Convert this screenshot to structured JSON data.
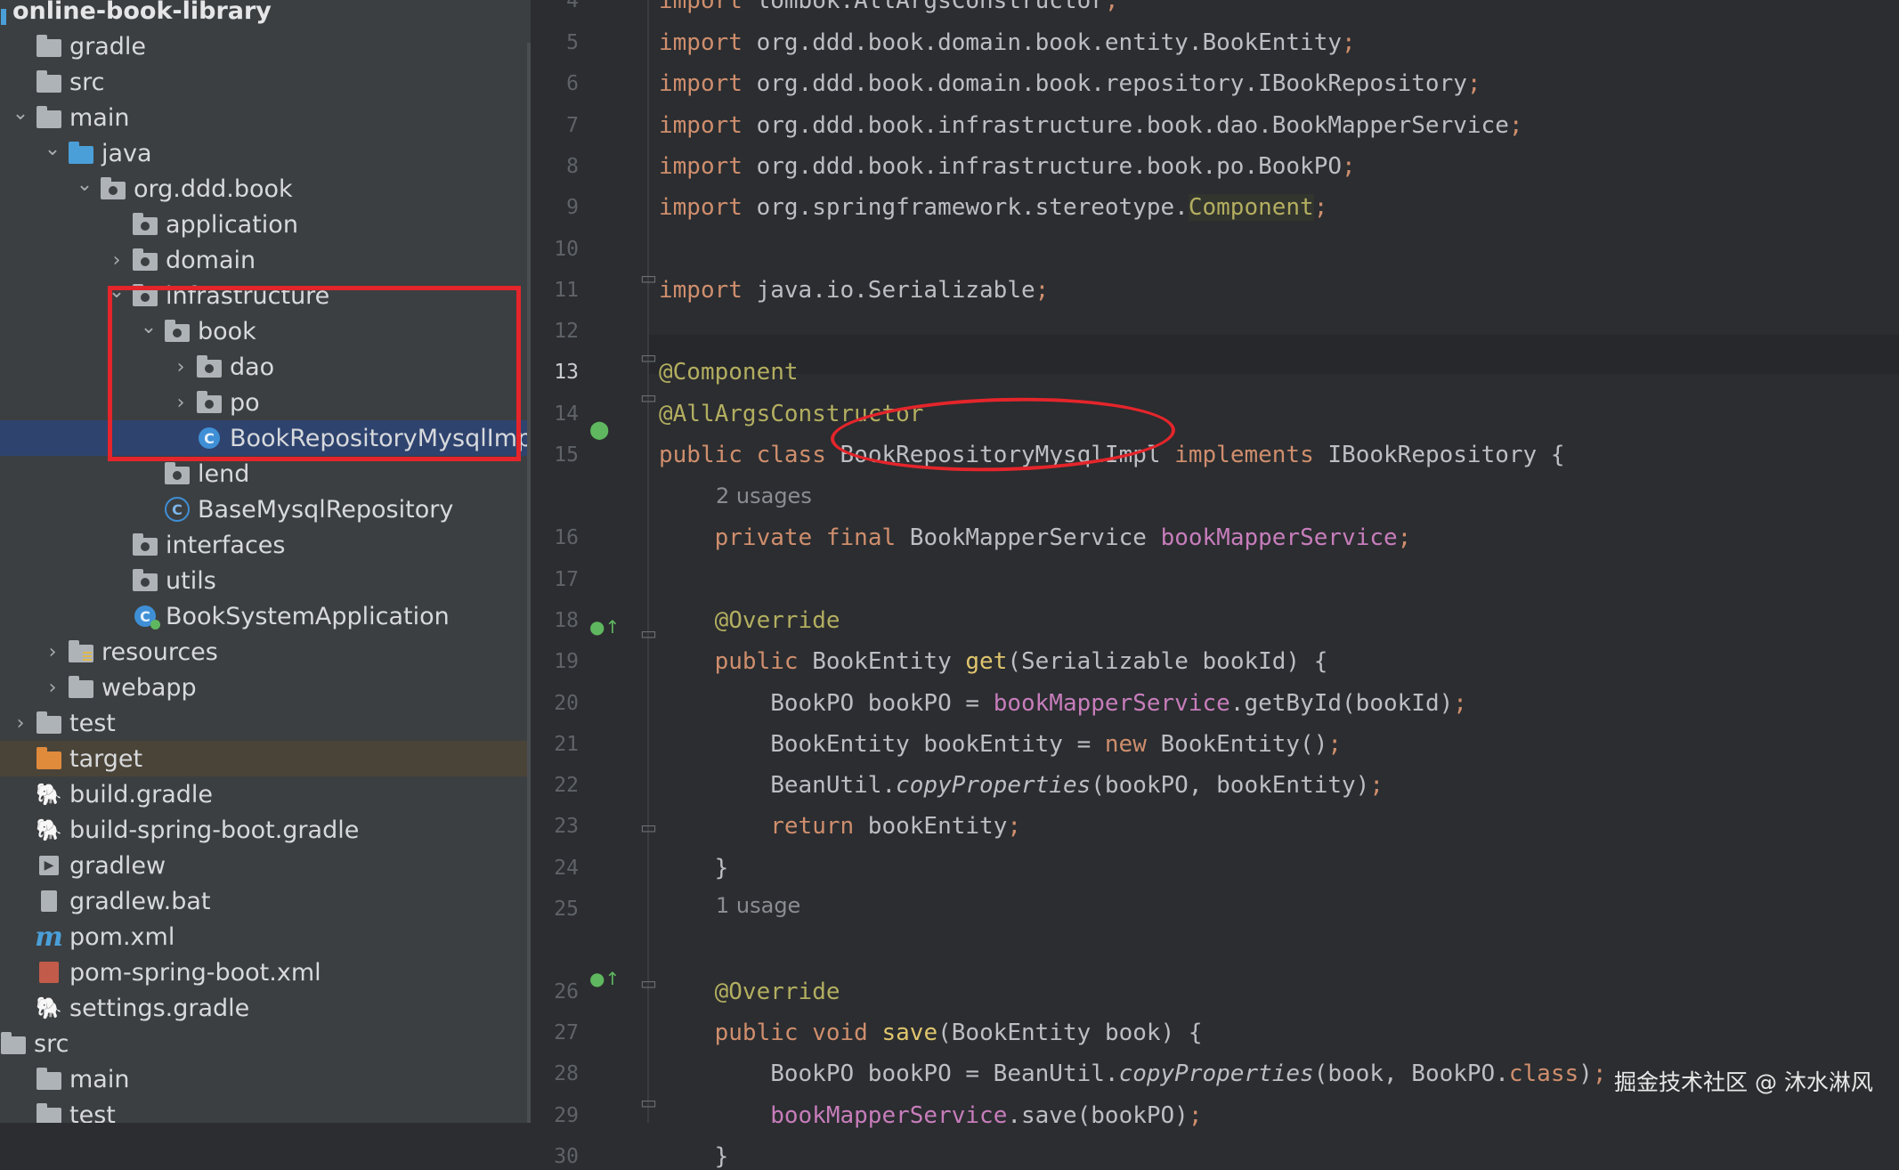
{
  "tree": {
    "items": [
      {
        "label": "online-book-library",
        "icon": "module-icon",
        "chev": "none"
      },
      {
        "label": "gradle",
        "icon": "folder-icon",
        "chev": "none"
      },
      {
        "label": "src",
        "icon": "folder-icon",
        "chev": "none"
      },
      {
        "label": "main",
        "icon": "folder-icon",
        "chev": "down"
      },
      {
        "label": "java",
        "icon": "source-folder-icon",
        "chev": "down"
      },
      {
        "label": "org.ddd.book",
        "icon": "package-icon",
        "chev": "down"
      },
      {
        "label": "application",
        "icon": "package-icon",
        "chev": "none"
      },
      {
        "label": "domain",
        "icon": "package-icon",
        "chev": "right"
      },
      {
        "label": "infrastructure",
        "icon": "package-icon",
        "chev": "down"
      },
      {
        "label": "book",
        "icon": "package-icon",
        "chev": "down"
      },
      {
        "label": "dao",
        "icon": "package-icon",
        "chev": "right"
      },
      {
        "label": "po",
        "icon": "package-icon",
        "chev": "right"
      },
      {
        "label": "BookRepositoryMysqlImpl",
        "icon": "class-icon",
        "chev": "none"
      },
      {
        "label": "lend",
        "icon": "package-icon",
        "chev": "none"
      },
      {
        "label": "BaseMysqlRepository",
        "icon": "abstract-class-icon",
        "chev": "none"
      },
      {
        "label": "interfaces",
        "icon": "package-icon",
        "chev": "none"
      },
      {
        "label": "utils",
        "icon": "package-icon",
        "chev": "none"
      },
      {
        "label": "BookSystemApplication",
        "icon": "spring-boot-app-icon",
        "chev": "none"
      },
      {
        "label": "resources",
        "icon": "resources-folder-icon",
        "chev": "right"
      },
      {
        "label": "webapp",
        "icon": "folder-icon",
        "chev": "right"
      },
      {
        "label": "test",
        "icon": "folder-icon",
        "chev": "right"
      },
      {
        "label": "target",
        "icon": "excluded-folder-icon",
        "chev": "none"
      },
      {
        "label": "build.gradle",
        "icon": "gradle-icon",
        "chev": "none"
      },
      {
        "label": "build-spring-boot.gradle",
        "icon": "gradle-icon",
        "chev": "none"
      },
      {
        "label": "gradlew",
        "icon": "shell-script-icon",
        "chev": "none"
      },
      {
        "label": "gradlew.bat",
        "icon": "file-icon",
        "chev": "none"
      },
      {
        "label": "pom.xml",
        "icon": "maven-icon",
        "chev": "none"
      },
      {
        "label": "pom-spring-boot.xml",
        "icon": "xml-file-icon",
        "chev": "none"
      },
      {
        "label": "settings.gradle",
        "icon": "gradle-icon",
        "chev": "none"
      },
      {
        "label": "src",
        "icon": "folder-icon",
        "chev": "none"
      },
      {
        "label": "main",
        "icon": "folder-icon",
        "chev": "none"
      },
      {
        "label": "test",
        "icon": "folder-icon",
        "chev": "none"
      }
    ]
  },
  "editor": {
    "lines": [
      {
        "n": "4",
        "code": "import lombok.AllArgsConstructor;"
      },
      {
        "n": "5",
        "code": "import org.ddd.book.domain.book.entity.BookEntity;"
      },
      {
        "n": "6",
        "code": "import org.ddd.book.domain.book.repository.IBookRepository;"
      },
      {
        "n": "7",
        "code": "import org.ddd.book.infrastructure.book.dao.BookMapperService;"
      },
      {
        "n": "8",
        "code": "import org.ddd.book.infrastructure.book.po.BookPO;"
      },
      {
        "n": "9",
        "code": "import org.springframework.stereotype.Component;"
      },
      {
        "n": "10",
        "code": ""
      },
      {
        "n": "11",
        "code": "import java.io.Serializable;"
      },
      {
        "n": "12",
        "code": ""
      },
      {
        "n": "13",
        "code": "@Component"
      },
      {
        "n": "14",
        "code": "@AllArgsConstructor"
      },
      {
        "n": "15",
        "code": "public class BookRepositoryMysqlImpl implements IBookRepository {"
      },
      {
        "n": "16",
        "code": "    private final BookMapperService bookMapperService;"
      },
      {
        "n": "17",
        "code": ""
      },
      {
        "n": "18",
        "code": "    @Override"
      },
      {
        "n": "19",
        "code": "    public BookEntity get(Serializable bookId) {"
      },
      {
        "n": "20",
        "code": "        BookPO bookPO = bookMapperService.getById(bookId);"
      },
      {
        "n": "21",
        "code": "        BookEntity bookEntity = new BookEntity();"
      },
      {
        "n": "22",
        "code": "        BeanUtil.copyProperties(bookPO, bookEntity);"
      },
      {
        "n": "23",
        "code": "        return bookEntity;"
      },
      {
        "n": "24",
        "code": "    }"
      },
      {
        "n": "25",
        "code": ""
      },
      {
        "n": "26",
        "code": "    @Override"
      },
      {
        "n": "27",
        "code": "    public void save(BookEntity book) {"
      },
      {
        "n": "28",
        "code": "        BookPO bookPO = BeanUtil.copyProperties(book, BookPO.class);"
      },
      {
        "n": "29",
        "code": "        bookMapperService.save(bookPO);"
      },
      {
        "n": "30",
        "code": "    }"
      }
    ],
    "current_line": "13",
    "usages_15": "2 usages",
    "usages_25": "1 usage"
  },
  "watermark": "掘金技术社区 @ 沐水淋风",
  "colors": {
    "highlight_box": "#e4252b",
    "keyword": "#cf8e6d",
    "annotation": "#b3ae60",
    "field": "#c77dbb"
  }
}
